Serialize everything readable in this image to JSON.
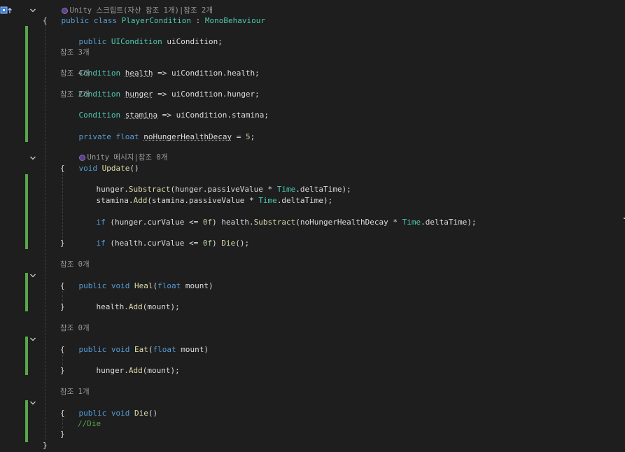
{
  "editor": {
    "line_above": "Unity 스크립트(자산 참조 1개)|참조 2개",
    "class_declaration": {
      "modifier": "public",
      "keyword": "class",
      "name": "PlayerCondition",
      "colon": " : ",
      "base": "MonoBehaviour"
    },
    "open_brace": "{",
    "close_brace": "}",
    "field_uicondition": {
      "modifier": "public",
      "type": "UICondition",
      "name": "uiCondition;"
    },
    "props": [
      {
        "refs": "참조 3개",
        "type": "Condition",
        "name": "health",
        "expr": " => uiCondition.health;"
      },
      {
        "refs": "참조 4개",
        "type": "Condition",
        "name": "hunger",
        "expr": " => uiCondition.hunger;"
      },
      {
        "refs": "참조 2개",
        "type": "Condition",
        "name": "stamina",
        "expr": " => uiCondition.stamina;"
      }
    ],
    "private_field": {
      "modifier": "private",
      "type": "float",
      "name": "noHungerHealthDecay",
      "eq": " = ",
      "value": "5",
      "semi": ";"
    },
    "update_method": {
      "codelens_unity": "Unity 메시지|참조 0개",
      "return_type": "void",
      "name": "Update",
      "params": "()",
      "body": {
        "l1_a": "hunger.",
        "l1_m": "Substract",
        "l1_b": "(hunger.passiveValue * ",
        "l1_c": "Time",
        "l1_d": ".deltaTime);",
        "l2_a": "stamina.",
        "l2_m": "Add",
        "l2_b": "(stamina.passiveValue * ",
        "l2_c": "Time",
        "l2_d": ".deltaTime);",
        "l3_if": "if",
        "l3_a": " (hunger.curValue <= ",
        "l3_n": "0f",
        "l3_b": ") health.",
        "l3_m": "Substract",
        "l3_c": "(noHungerHealthDecay * ",
        "l3_t": "Time",
        "l3_d": ".deltaTime);",
        "l4_if": "if",
        "l4_a": " (health.curValue <= ",
        "l4_n": "0f",
        "l4_b": ") ",
        "l4_m": "Die",
        "l4_c": "();"
      }
    },
    "heal_method": {
      "refs": "참조 0개",
      "modifier": "public",
      "return_type": "void",
      "name": "Heal",
      "open": "(",
      "param_type": "float",
      "param_name": "mount",
      "close": ")",
      "body_a": "health.",
      "body_m": "Add",
      "body_b": "(mount);"
    },
    "eat_method": {
      "refs": "참조 0개",
      "modifier": "public",
      "return_type": "void",
      "name": "Eat",
      "open": "(",
      "param_type": "float",
      "param_name": "mount",
      "close": ")",
      "body_a": "hunger.",
      "body_m": "Add",
      "body_b": "(mount);"
    },
    "die_method": {
      "refs": "참조 1개",
      "modifier": "public",
      "return_type": "void",
      "name": "Die",
      "params": "()",
      "comment": "//Die"
    }
  },
  "colors": {
    "background": "#1e1e1e",
    "keyword": "#569cd6",
    "class_name": "#4ec9b0",
    "method": "#dcdcaa",
    "number": "#b5cea8",
    "comment": "#57a64a",
    "identifier": "#dcdcdc",
    "codelens": "#999999",
    "change_bar": "#57a64a"
  },
  "icons": [
    "class-member-icon",
    "fold-chevron-icon",
    "unity-message-icon"
  ]
}
